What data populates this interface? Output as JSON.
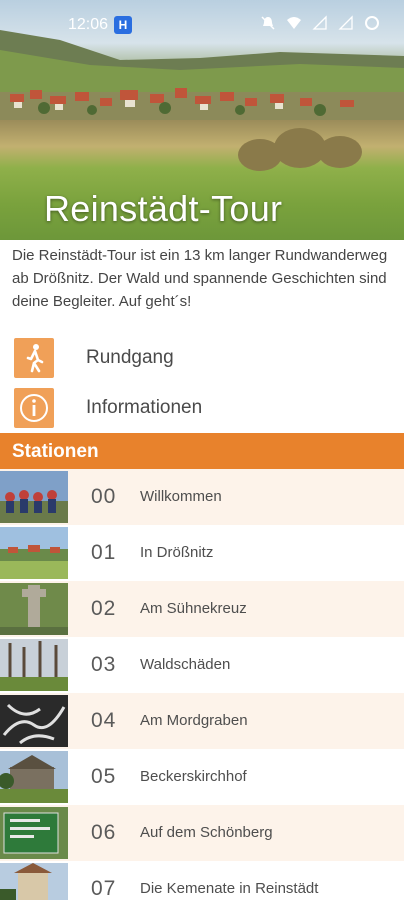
{
  "status_bar": {
    "time": "12:06",
    "app_badge": "H",
    "icons": [
      "do-not-disturb-icon",
      "wifi-icon",
      "signal-icon",
      "signal-icon-2",
      "battery-ring-icon"
    ]
  },
  "hero": {
    "title": "Reinstädt-Tour"
  },
  "description": "Die Reinstädt-Tour ist ein 13 km langer Rundwanderweg ab Drößnitz. Der Wald und spannende Geschichten sind deine Begleiter. Auf geht´s!",
  "menu": [
    {
      "label": "Rundgang",
      "icon": "walking-person-icon"
    },
    {
      "label": "Informationen",
      "icon": "info-icon"
    }
  ],
  "stations_header": "Stationen",
  "stations": [
    {
      "number": "00",
      "name": "Willkommen"
    },
    {
      "number": "01",
      "name": "In Drößnitz"
    },
    {
      "number": "02",
      "name": "Am Sühnekreuz"
    },
    {
      "number": "03",
      "name": "Waldschäden"
    },
    {
      "number": "04",
      "name": "Am Mordgraben"
    },
    {
      "number": "05",
      "name": "Beckerskirchhof"
    },
    {
      "number": "06",
      "name": "Auf dem Schönberg"
    },
    {
      "number": "07",
      "name": "Die Kemenate in Reinstädt"
    }
  ],
  "colors": {
    "accent": "#e8822c",
    "icon_tile": "#f0a058",
    "row_alt": "#fdf3ea"
  }
}
